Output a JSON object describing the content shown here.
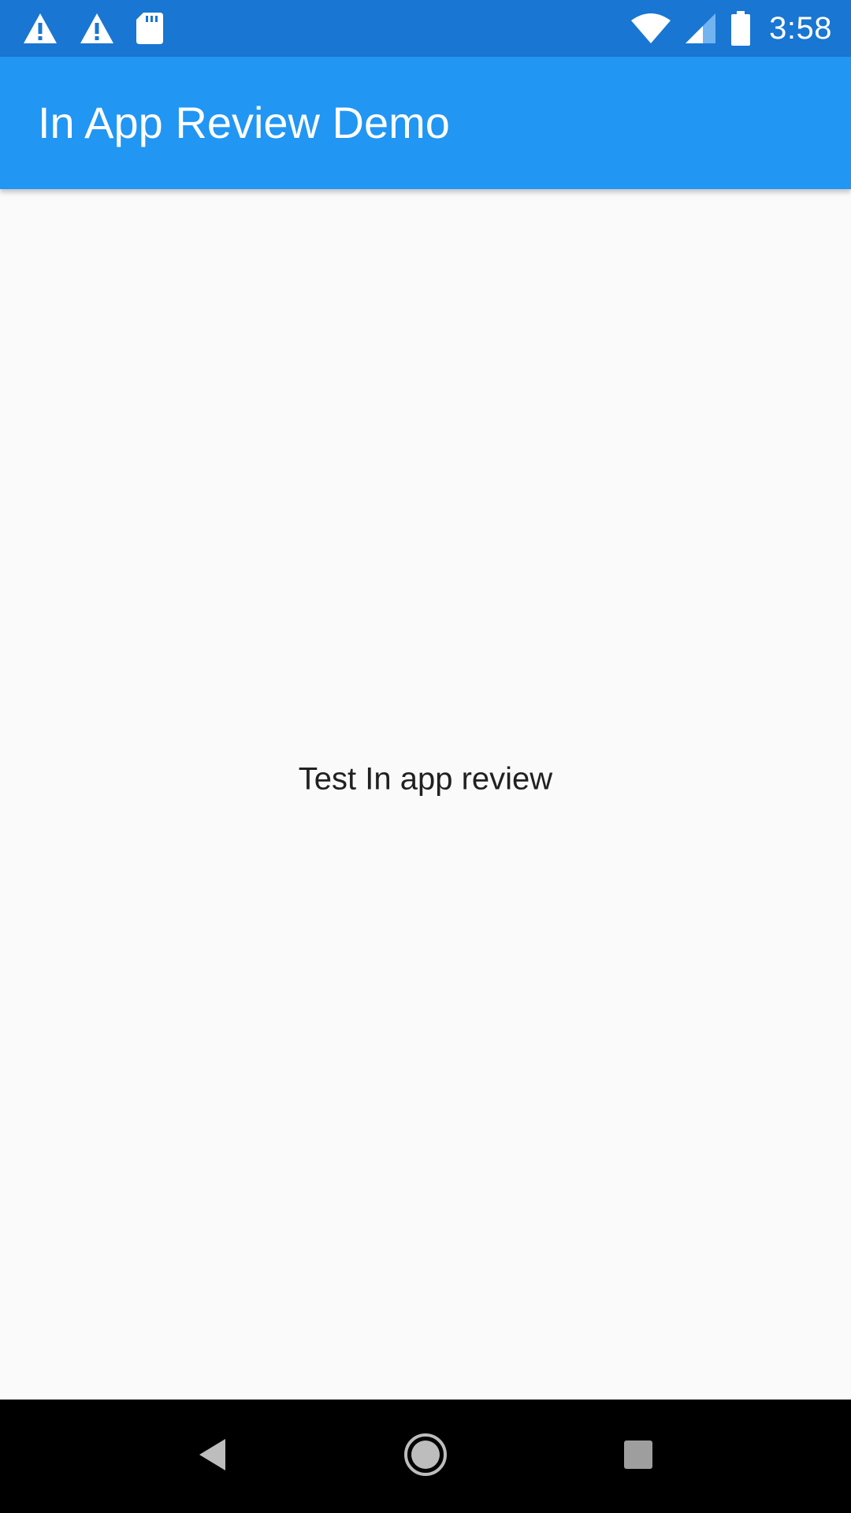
{
  "status_bar": {
    "time": "3:58",
    "left_icons": [
      "warning-icon",
      "warning-icon",
      "sd-card-icon"
    ],
    "right_icons": [
      "wifi-icon",
      "cellular-signal-icon",
      "battery-icon"
    ]
  },
  "app_bar": {
    "title": "In App Review Demo",
    "color": "#2196f3"
  },
  "main": {
    "button_label": "Test In app review"
  },
  "nav_bar": {
    "buttons": [
      "back-icon",
      "home-icon",
      "recents-icon"
    ]
  },
  "colors": {
    "status_bar": "#1976d2",
    "background": "#fafafa",
    "text": "#212121"
  }
}
